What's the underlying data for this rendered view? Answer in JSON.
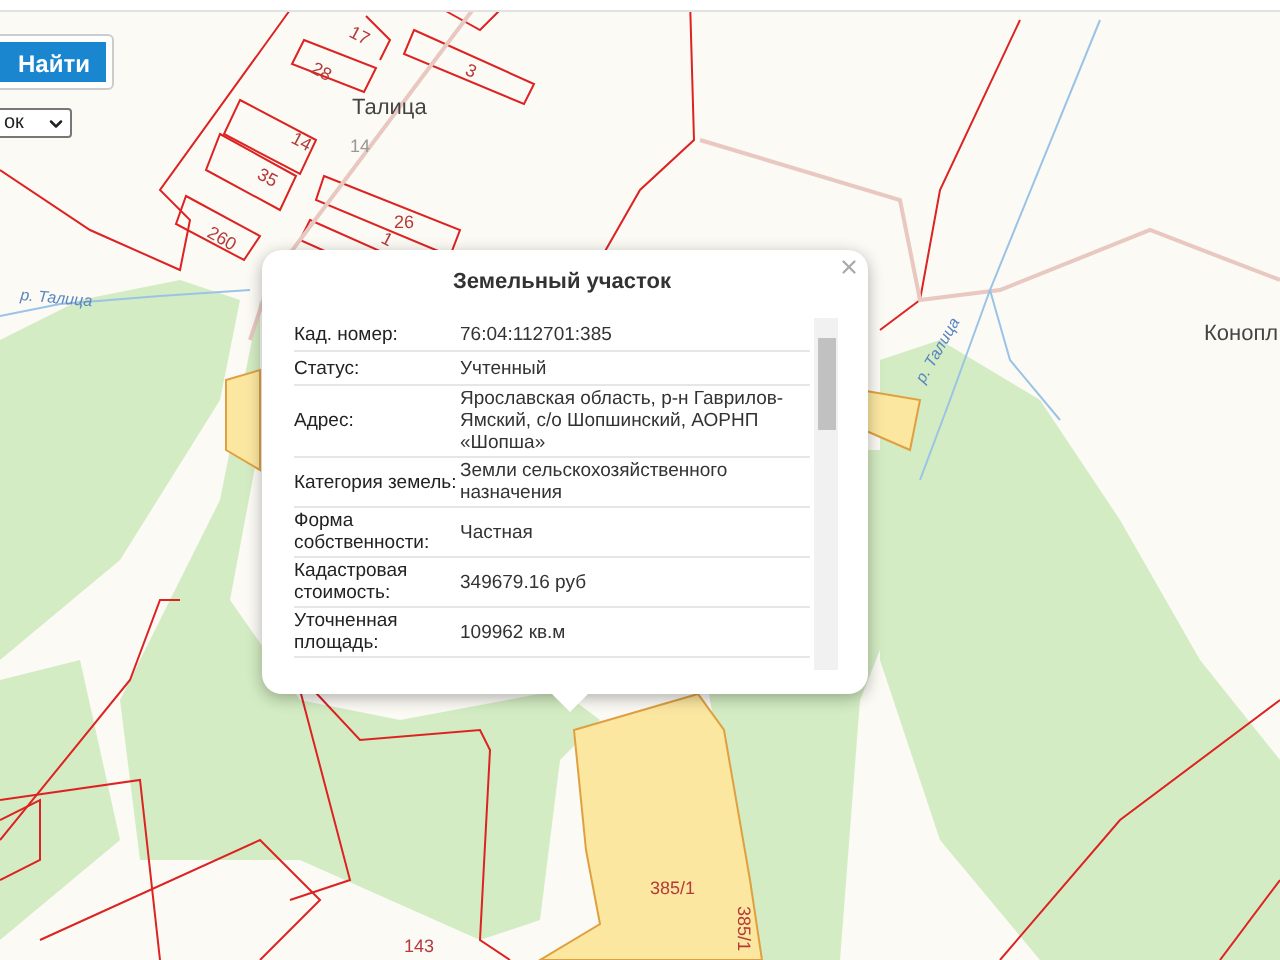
{
  "search_button": {
    "label": "Найти"
  },
  "layer_select": {
    "value": "ок"
  },
  "map_labels": [
    {
      "text": "17",
      "kind": "parcel"
    },
    {
      "text": "28",
      "kind": "parcel"
    },
    {
      "text": "3",
      "kind": "parcel"
    },
    {
      "text": "Талица",
      "kind": "place"
    },
    {
      "text": "14",
      "kind": "parcel"
    },
    {
      "text": "14",
      "kind": "road"
    },
    {
      "text": "35",
      "kind": "parcel"
    },
    {
      "text": "26",
      "kind": "parcel"
    },
    {
      "text": "1",
      "kind": "parcel"
    },
    {
      "text": "260",
      "kind": "parcel"
    },
    {
      "text": "р. Талица",
      "kind": "river"
    },
    {
      "text": "р. Талица",
      "kind": "river"
    },
    {
      "text": "Конопл",
      "kind": "place"
    },
    {
      "text": "385/1",
      "kind": "parcel"
    },
    {
      "text": "385/1",
      "kind": "parcel"
    },
    {
      "text": "143",
      "kind": "parcel"
    }
  ],
  "popup": {
    "title": "Земельный участок",
    "rows": [
      {
        "label": "Кад. номер:",
        "value": "76:04:112701:385"
      },
      {
        "label": "Статус:",
        "value": "Учтенный"
      },
      {
        "label": "Адрес:",
        "value": "Ярославская область, р-н Гаврилов-Ямский, с/о Шопшинский, АОРНП «Шопша»"
      },
      {
        "label": "Категория земель:",
        "value": "Земли сельскохозяйственного назначения"
      },
      {
        "label": "Форма собственности:",
        "value": "Частная"
      },
      {
        "label": "Кадастровая стоимость:",
        "value": "349679.16 руб"
      },
      {
        "label": "Уточненная площадь:",
        "value": "109962 кв.м"
      }
    ]
  }
}
